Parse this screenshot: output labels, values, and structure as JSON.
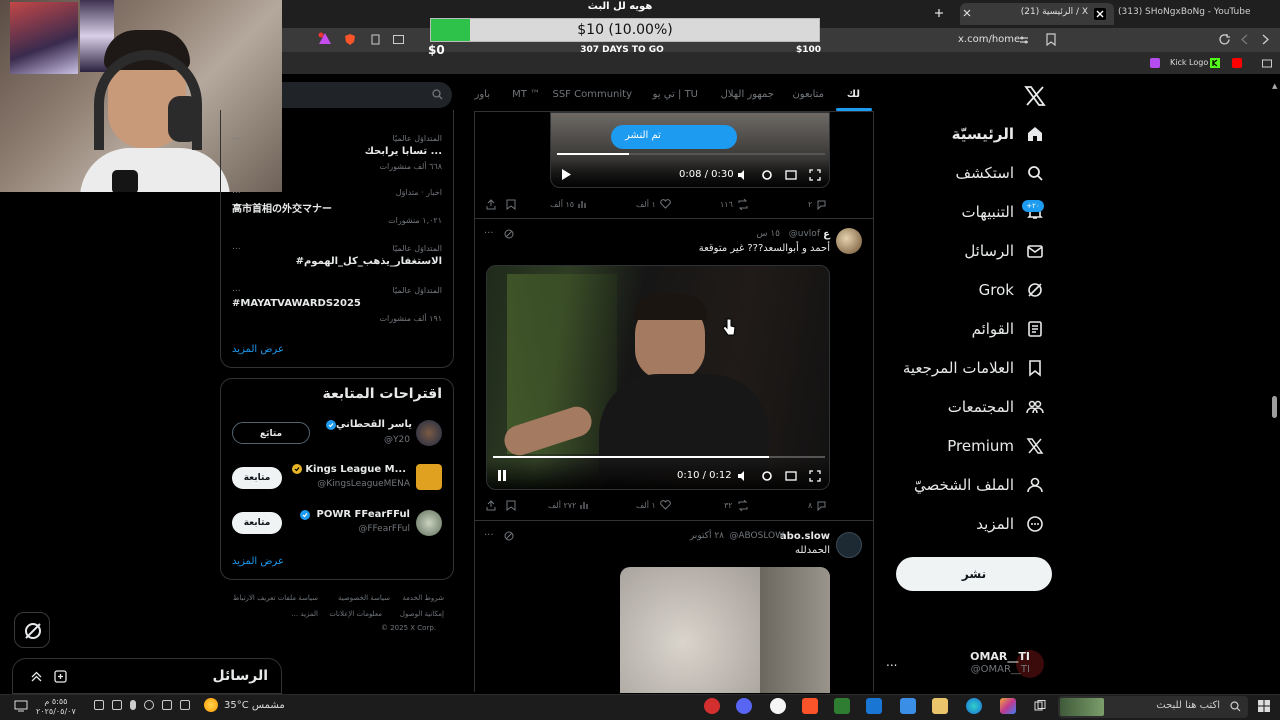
{
  "browser": {
    "tab_active": "(21) الرئيسية / X",
    "tab_other": "(313) SHoNgxBoNg - YouTube",
    "url": "x.com/home",
    "bookmark": "Kick Logo"
  },
  "goal": {
    "title": "هويه لل البث",
    "progress_text": "$10 (10.00%)",
    "progress_fraction": 0.1,
    "min_label": "$0",
    "max_label": "$100",
    "days_label": "307 DAYS TO GO",
    "fill_color": "#2ec24b"
  },
  "nav": {
    "items": [
      {
        "label": "الرئيسيّة",
        "icon": "home-icon"
      },
      {
        "label": "استكشف",
        "icon": "search-icon"
      },
      {
        "label": "التنبيهات",
        "icon": "bell-icon"
      },
      {
        "label": "الرسائل",
        "icon": "mail-icon"
      },
      {
        "label": "Grok",
        "icon": "grok-icon"
      },
      {
        "label": "القوائم",
        "icon": "list-icon"
      },
      {
        "label": "العلامات المرجعية",
        "icon": "bookmark-icon"
      },
      {
        "label": "المجتمعات",
        "icon": "communities-icon"
      },
      {
        "label": "Premium",
        "icon": "x-icon"
      },
      {
        "label": "الملف الشخصيّ",
        "icon": "profile-icon"
      },
      {
        "label": "المزيد",
        "icon": "more-circle-icon"
      }
    ],
    "notif_badge": "+٢٠",
    "post_button": "نشر",
    "account_name": "OMAR__TI",
    "account_handle": "@OMAR__TI",
    "account_more": "..."
  },
  "timeline": {
    "tabs": [
      "لك",
      "متابعون",
      "جمهور الهلال",
      "تي يو | TU",
      "SSF Community",
      "MT ™",
      "باور"
    ],
    "post1": {
      "video_time": "0:08 / 0:30",
      "video_progress": 0.27,
      "overlay_text": "تم النشر",
      "replies": "٢",
      "reposts": "١١٦",
      "likes": "١ ألف",
      "views": "١٥ ألف"
    },
    "post2": {
      "name": "ع",
      "handle": "@uvlof",
      "time": "١٥ س",
      "text": "أحمد و أبوالسعد??? غير متوقعة",
      "video_time": "0:10 / 0:12",
      "video_progress": 0.83,
      "replies": "٨",
      "reposts": "٣٢",
      "likes": "١ ألف",
      "views": "٢٧٢ ألف"
    },
    "post3": {
      "name": "abo.slow",
      "handle": "@ABOSLOW",
      "time": "٢٨ أكتوبر",
      "text": "الحمدلله"
    }
  },
  "sidebar": {
    "trends": [
      {
        "meta": "المتداوَل عالميًا",
        "title": "تسابا يرابحك ...",
        "count": "٦٦٨ ألف منشورات"
      },
      {
        "meta": "اخبار · متداوَل",
        "title": "高市首相の外交マナー",
        "count": "١,٠٢١ منشورات"
      },
      {
        "meta": "المتداوَل عالميًا",
        "title": "#الاستغفار_يذهب_كل_الهموم",
        "count": ""
      },
      {
        "meta": "المتداوَل عالميًا",
        "title": "#MAYATVAWARDS2025",
        "count": "١٩١ ألف منشورات"
      }
    ],
    "trends_more": "...",
    "show_more": "عرض المزيد",
    "who_to_follow": "اقتراحات المتابعة",
    "suggestions": [
      {
        "name": "ياسر القحطاني",
        "handle": "@Y20",
        "button": "متابَع"
      },
      {
        "name": "Kings League M...",
        "handle": "@KingsLeagueMENA",
        "button": "متابعة"
      },
      {
        "name": "POWR FFearFFul",
        "handle": "@FFearFFul",
        "button": "متابعة"
      }
    ],
    "show_more_2": "عرض المزيد",
    "footer": [
      "شروط الخدمة",
      "سياسة الخصوصية",
      "سياسة ملفات تعريف الارتباط",
      "إمكانية الوصول",
      "معلومات الإعلانات",
      "... المزيد",
      "© 2025 X Corp."
    ]
  },
  "messages": {
    "title": "الرسائل"
  },
  "taskbar": {
    "search_placeholder": "اكتب هنا للبحث",
    "weather": "35°C مشمس",
    "time": "٥:٥٥ م",
    "date": "٢٠٢٥/٠٥/٠٧"
  }
}
